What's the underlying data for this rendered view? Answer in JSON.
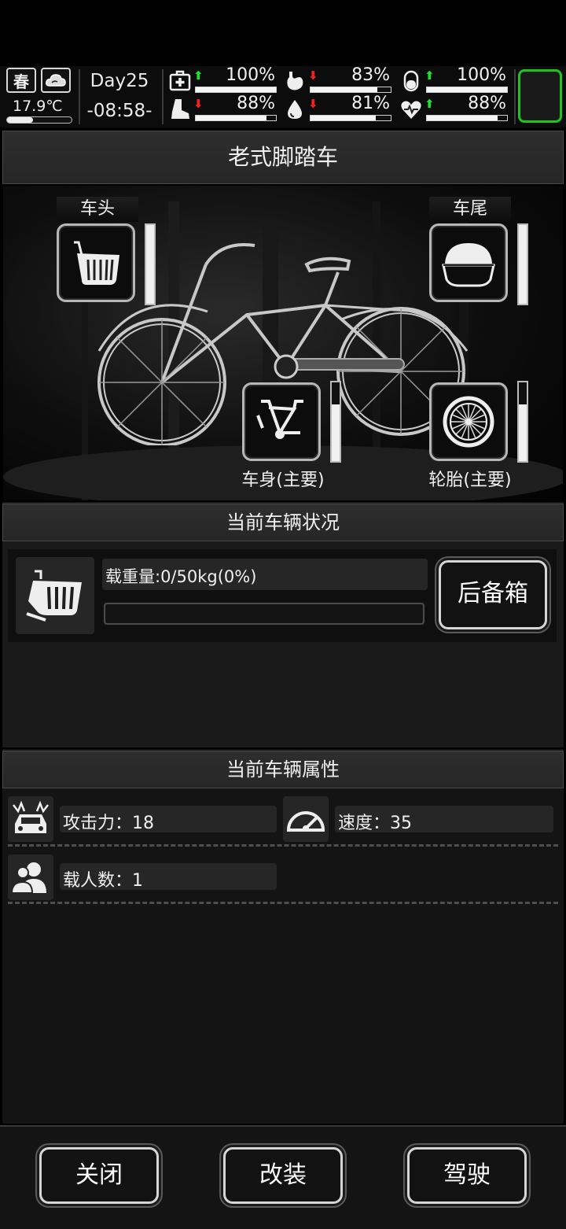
{
  "status": {
    "season": "春",
    "weather_icon": "cloud-icon",
    "temperature": "17.9℃",
    "temperature_level": 0.4,
    "day": "Day25",
    "time": "-08:58-",
    "stats": [
      {
        "name": "health",
        "icon": "medkit-icon",
        "trend": "up",
        "value": "100%",
        "level": 1.0
      },
      {
        "name": "hunger",
        "icon": "stomach-icon",
        "trend": "down",
        "value": "83%",
        "level": 0.83
      },
      {
        "name": "energy",
        "icon": "pill-icon",
        "trend": "up",
        "value": "100%",
        "level": 1.0
      },
      {
        "name": "stamina",
        "icon": "boot-icon",
        "trend": "down",
        "value": "88%",
        "level": 0.88
      },
      {
        "name": "thirst",
        "icon": "water-drop-icon",
        "trend": "down",
        "value": "81%",
        "level": 0.81
      },
      {
        "name": "mood",
        "icon": "heart-icon",
        "trend": "up",
        "value": "88%",
        "level": 0.88
      }
    ]
  },
  "vehicle": {
    "title": "老式脚踏车",
    "slots": {
      "front": {
        "label": "车头",
        "icon": "basket-icon",
        "level": 1.0
      },
      "rear": {
        "label": "车尾",
        "icon": "rear-box-icon",
        "level": 1.0
      },
      "body": {
        "label": "车身(主要)",
        "icon": "bike-frame-icon",
        "level": 0.72
      },
      "tire": {
        "label": "轮胎(主要)",
        "icon": "wheel-icon",
        "level": 0.72
      }
    }
  },
  "condition": {
    "header": "当前车辆状况",
    "load_text": "载重量:0/50kg(0%)",
    "load_fraction": 0,
    "trunk_button": "后备箱"
  },
  "attributes": {
    "header": "当前车辆属性",
    "items": [
      {
        "icon": "crash-car-icon",
        "text": "攻击力：18"
      },
      {
        "icon": "speedometer-icon",
        "text": "速度：35"
      },
      {
        "icon": "people-icon",
        "text": "载人数：1"
      }
    ]
  },
  "footer": {
    "close": "关闭",
    "modify": "改装",
    "drive": "驾驶"
  },
  "colors": {
    "accent_green": "#1fc41f",
    "arrow_up": "#22dd33",
    "arrow_down": "#ee2222"
  }
}
